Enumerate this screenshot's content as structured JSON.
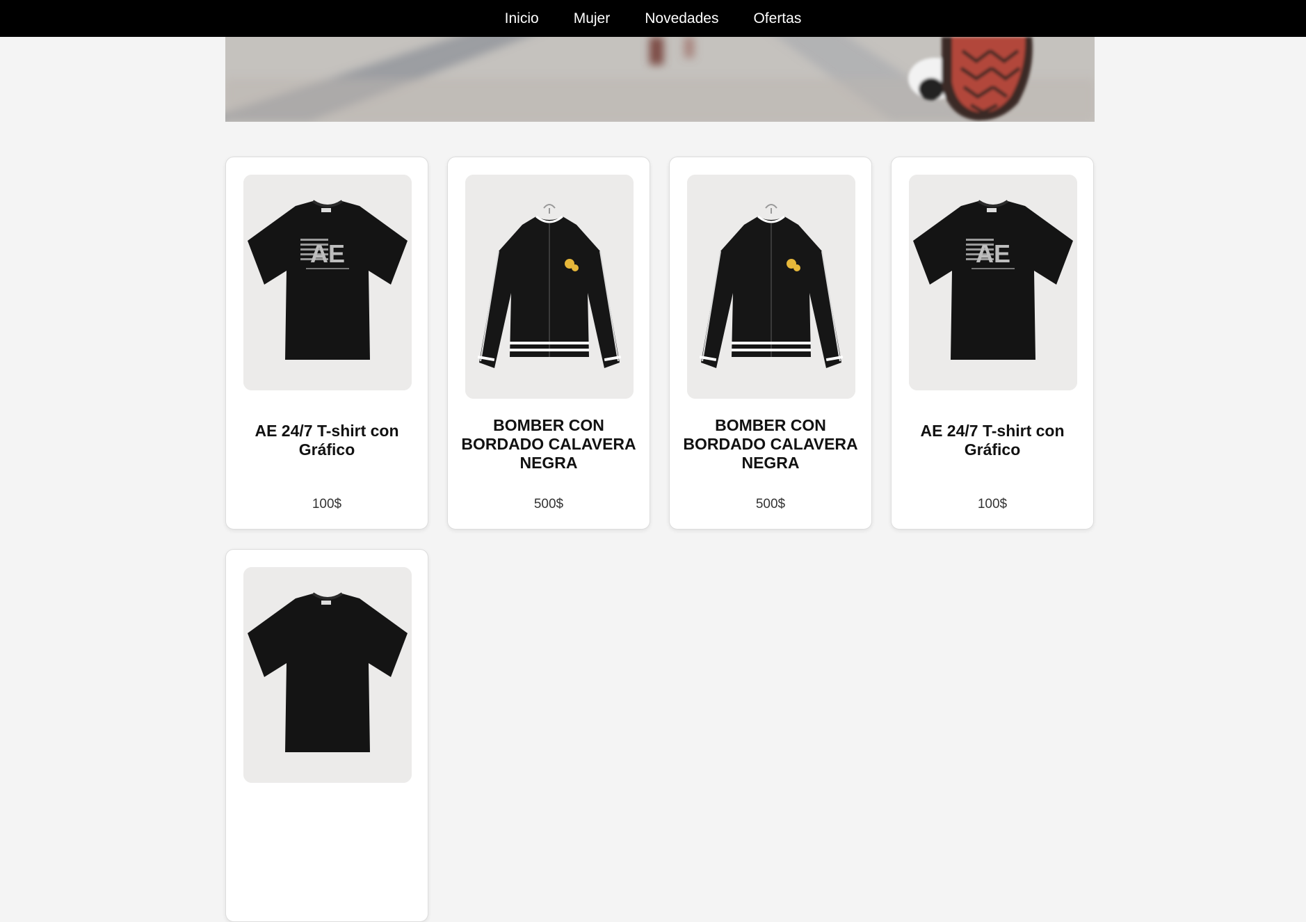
{
  "nav": {
    "items": [
      {
        "label": "Inicio"
      },
      {
        "label": "Mujer"
      },
      {
        "label": "Novedades"
      },
      {
        "label": "Ofertas"
      }
    ]
  },
  "products": [
    {
      "title": "AE 24/7 T-shirt con Gráfico",
      "price": "100$",
      "image": "tshirt-image"
    },
    {
      "title": "BOMBER CON BORDADO CALAVERA NEGRA",
      "price": "500$",
      "image": "bomber-jacket-image"
    },
    {
      "title": "BOMBER CON BORDADO CALAVERA NEGRA",
      "price": "500$",
      "image": "bomber-jacket-image"
    },
    {
      "title": "AE 24/7 T-shirt con Gráfico",
      "price": "100$",
      "image": "tshirt-image"
    },
    {
      "title": "",
      "price": "",
      "image": "tshirt-image"
    }
  ]
}
